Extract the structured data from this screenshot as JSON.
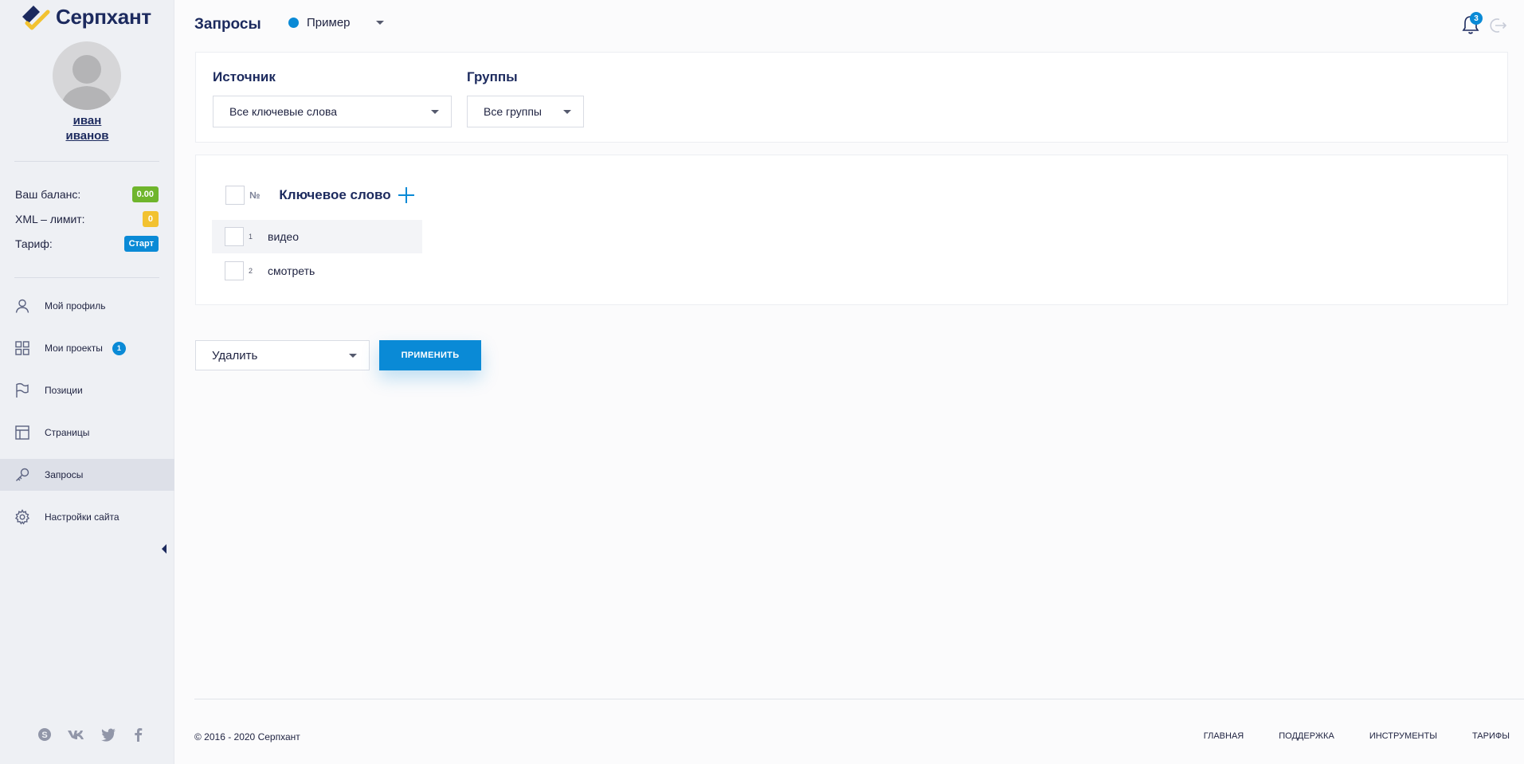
{
  "brand": {
    "name": "Серпхант"
  },
  "user": {
    "first_name": "иван",
    "last_name": "иванов"
  },
  "stats": [
    {
      "label": "Ваш баланс:",
      "value": "0.00",
      "color": "#6fb52c"
    },
    {
      "label": "XML – лимит:",
      "value": "0",
      "color": "#f2c230"
    },
    {
      "label": "Тариф:",
      "value": "Старт",
      "color": "#0a8ad6"
    }
  ],
  "nav": {
    "items": [
      {
        "label": "Мой профиль",
        "icon": "user-icon"
      },
      {
        "label": "Мои проекты",
        "icon": "grid-icon",
        "count": "1"
      },
      {
        "label": "Позиции",
        "icon": "flag-icon"
      },
      {
        "label": "Страницы",
        "icon": "layout-icon"
      },
      {
        "label": "Запросы",
        "icon": "key-icon",
        "active": true
      },
      {
        "label": "Настройки сайта",
        "icon": "gear-icon"
      }
    ]
  },
  "header": {
    "title": "Запросы",
    "project": "Пример",
    "notifications_count": "3"
  },
  "filters": {
    "source_label": "Источник",
    "source_value": "Все ключевые слова",
    "groups_label": "Группы",
    "groups_value": "Все группы"
  },
  "table": {
    "num_header": "№",
    "keyword_header": "Ключевое слово",
    "rows": [
      {
        "num": "1",
        "keyword": "видео"
      },
      {
        "num": "2",
        "keyword": "смотреть"
      }
    ]
  },
  "bulk": {
    "action_value": "Удалить",
    "apply_label": "ПРИМЕНИТЬ"
  },
  "footer": {
    "copyright": "© 2016 - 2020 Серпхант",
    "links": [
      "ГЛАВНАЯ",
      "ПОДДЕРЖКА",
      "ИНСТРУМЕНТЫ",
      "ТАРИФЫ"
    ]
  },
  "colors": {
    "accent": "#0a8ad6",
    "brand_dark": "#1c2a5e",
    "sidebar_bg": "#eef0f4"
  }
}
